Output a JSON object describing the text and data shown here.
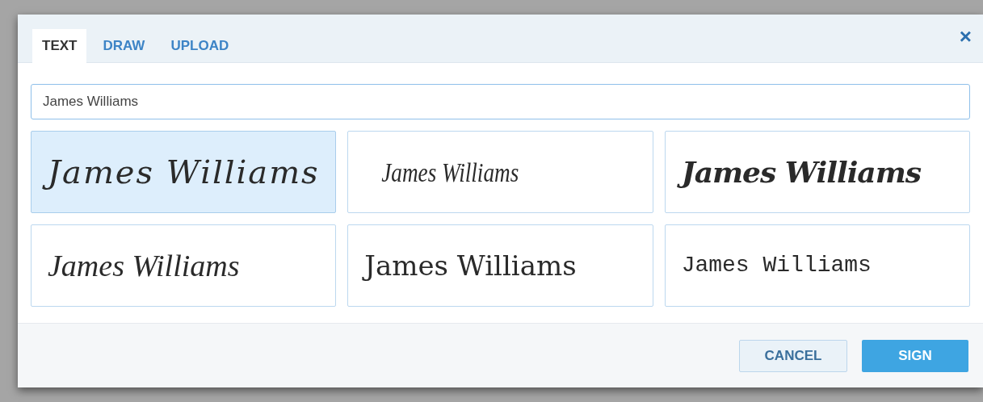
{
  "tabs": [
    {
      "label": "TEXT",
      "selected": true
    },
    {
      "label": "DRAW",
      "selected": false
    },
    {
      "label": "UPLOAD",
      "selected": false
    }
  ],
  "close": "×",
  "name_field": {
    "value": "James Williams"
  },
  "signatures": [
    {
      "text": "James Williams",
      "selected": true
    },
    {
      "text": "James Williams",
      "selected": false
    },
    {
      "text": "James Williams",
      "selected": false
    },
    {
      "text": "James Williams",
      "selected": false
    },
    {
      "text": "James Williams",
      "selected": false
    },
    {
      "text": "James Williams",
      "selected": false
    }
  ],
  "buttons": {
    "cancel": "CANCEL",
    "sign": "SIGN"
  }
}
